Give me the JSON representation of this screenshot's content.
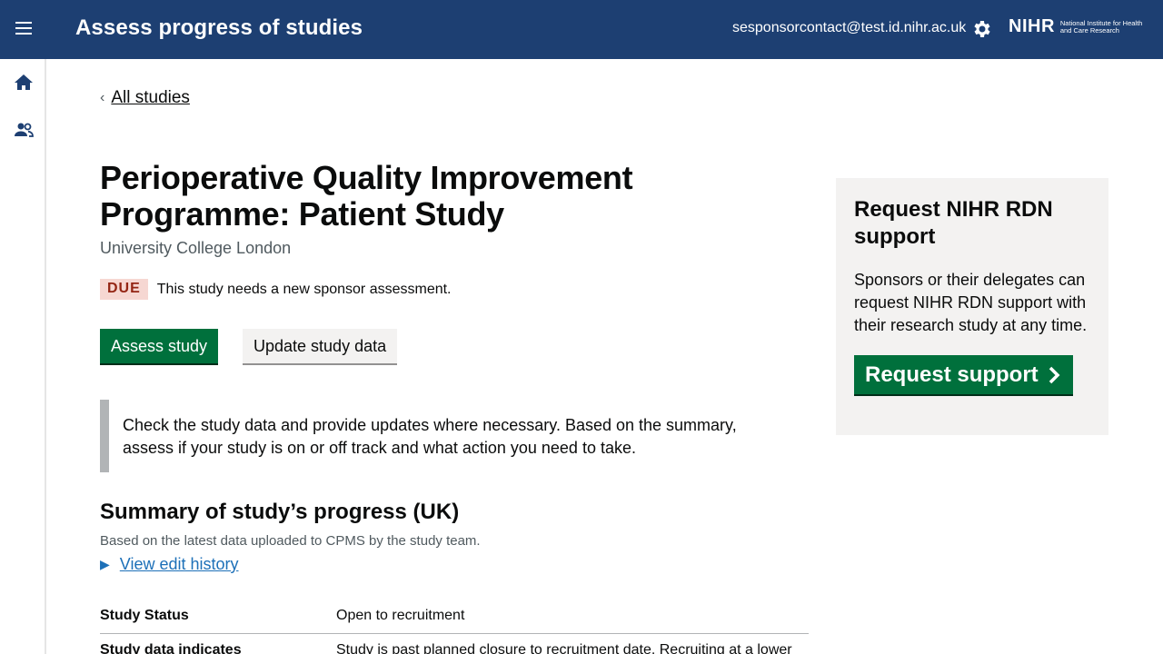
{
  "header": {
    "app_title": "Assess progress of studies",
    "user_email": "sesponsorcontact@test.id.nihr.ac.uk",
    "logo_mark": "NIHR",
    "logo_text": "National Institute for Health and Care Research",
    "menu_icon": "menu-icon",
    "settings_icon": "gear-icon"
  },
  "sidebar": {
    "items": [
      {
        "icon": "home-icon"
      },
      {
        "icon": "people-icon"
      }
    ]
  },
  "breadcrumb": {
    "back_label": "All studies"
  },
  "study": {
    "title": "Perioperative Quality Improvement Programme: Patient Study",
    "organisation": "University College London",
    "status_tag": "DUE",
    "status_message": "This study needs a new sponsor assessment."
  },
  "actions": {
    "assess_label": "Assess study",
    "update_label": "Update study data"
  },
  "inset_text": "Check the study data and provide updates where necessary. Based on the summary, assess if your study is on or off track and what action you need to take.",
  "summary": {
    "heading": "Summary of study’s progress (UK)",
    "hint": "Based on the latest data uploaded to CPMS by the study team.",
    "history_link": "View edit history",
    "rows": [
      {
        "key": "Study Status",
        "value": "Open to recruitment"
      },
      {
        "key": "Study data indicates",
        "value": "Study is past planned closure to recruitment date. Recruiting at a lower"
      }
    ]
  },
  "support": {
    "heading": "Request NIHR RDN support",
    "body": "Sponsors or their delegates can request NIHR RDN support with their research study at any time.",
    "button_label": "Request support"
  },
  "colors": {
    "header_bg": "#1d3f72",
    "primary_green": "#00703c",
    "due_tag_bg": "#f6d7d2",
    "due_tag_text": "#942514",
    "link_blue": "#1d70b8"
  }
}
